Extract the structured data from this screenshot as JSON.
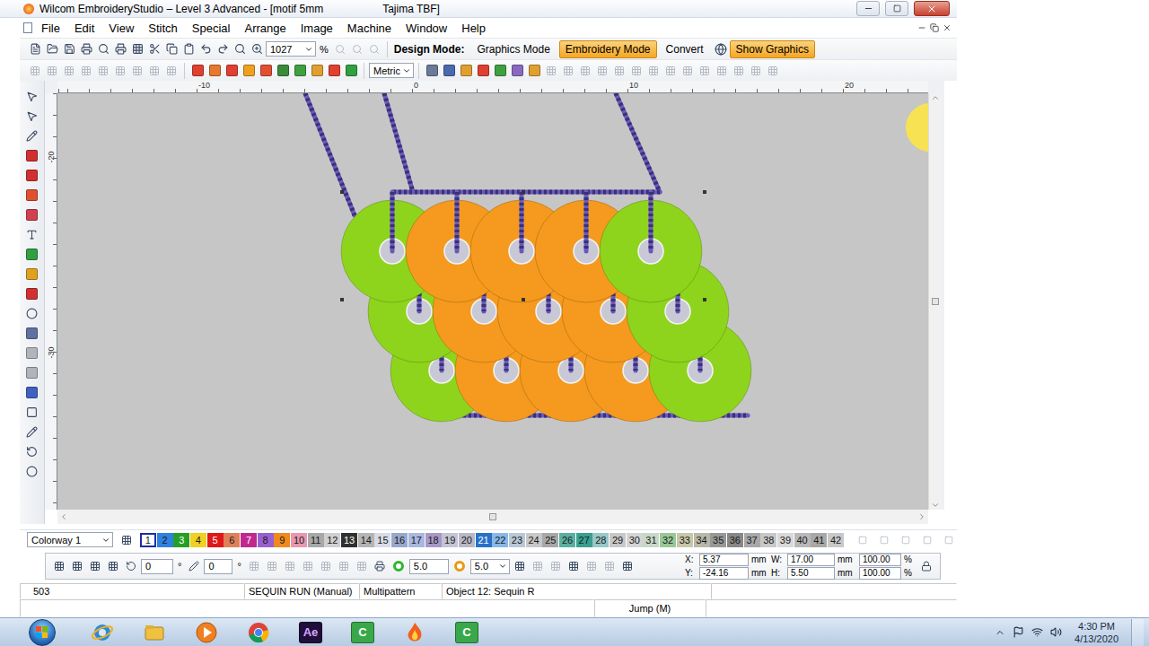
{
  "window": {
    "title": "Wilcom EmbroideryStudio – Level 3 Advanced - [motif 5mm",
    "document_info": "Tajima TBF]"
  },
  "menu": [
    "File",
    "Edit",
    "View",
    "Stitch",
    "Special",
    "Arrange",
    "Image",
    "Machine",
    "Window",
    "Help"
  ],
  "toolbar": {
    "zoom": "1027",
    "zoom_unit": "%",
    "design_mode_label": "Design Mode:",
    "modes": [
      {
        "label": "Graphics Mode",
        "selected": false
      },
      {
        "label": "Embroidery Mode",
        "selected": true
      }
    ],
    "convert": "Convert",
    "show_graphics": {
      "label": "Show Graphics",
      "on": true
    },
    "units": "Metric"
  },
  "rulers": {
    "horizontal": [
      "-10",
      "0",
      "10",
      "20"
    ],
    "vertical": [
      "-20",
      "-30"
    ]
  },
  "design": {
    "rows": [
      {
        "sequins": [
          {
            "color": "#8ed41c"
          },
          {
            "color": "#f59a1e"
          },
          {
            "color": "#f59a1e"
          },
          {
            "color": "#f59a1e"
          },
          {
            "color": "#8ed41c"
          }
        ]
      },
      {
        "sequins": [
          {
            "color": "#8ed41c"
          },
          {
            "color": "#f59a1e"
          },
          {
            "color": "#f59a1e"
          },
          {
            "color": "#f59a1e"
          },
          {
            "color": "#8ed41c"
          }
        ]
      },
      {
        "sequins": [
          {
            "color": "#8ed41c"
          },
          {
            "color": "#f59a1e"
          },
          {
            "color": "#f59a1e"
          },
          {
            "color": "#f59a1e"
          },
          {
            "color": "#8ed41c"
          }
        ]
      }
    ]
  },
  "palette": {
    "colorway": "Colorway 1",
    "swatches": [
      {
        "label": "1",
        "color": "#ffffff",
        "selected": true
      },
      {
        "label": "2",
        "color": "#2f80e0",
        "selected": false
      },
      {
        "label": "3",
        "color": "#25a025",
        "selected": false
      },
      {
        "label": "4",
        "color": "#f0d020",
        "selected": false
      },
      {
        "label": "5",
        "color": "#e01818",
        "selected": false
      },
      {
        "label": "6",
        "color": "#e0805a",
        "selected": false
      },
      {
        "label": "7",
        "color": "#c02890",
        "selected": false
      },
      {
        "label": "8",
        "color": "#9860d0",
        "selected": false
      },
      {
        "label": "9",
        "color": "#f08a1c",
        "selected": false
      },
      {
        "label": "10",
        "color": "#e898b0",
        "selected": false
      },
      {
        "label": "11",
        "color": "#a8a8a8",
        "selected": false
      },
      {
        "label": "12",
        "color": "#d0d0d0",
        "selected": false
      },
      {
        "label": "13",
        "color": "#303030",
        "selected": false
      },
      {
        "label": "14",
        "color": "#b4b4b4",
        "selected": false
      },
      {
        "label": "15",
        "color": "#d8dce8",
        "selected": false
      },
      {
        "label": "16",
        "color": "#98a8cc",
        "selected": false
      },
      {
        "label": "17",
        "color": "#a8b8e0",
        "selected": false
      },
      {
        "label": "18",
        "color": "#a898c8",
        "selected": false
      },
      {
        "label": "19",
        "color": "#c4c4d4",
        "selected": false
      },
      {
        "label": "20",
        "color": "#b8b8c8",
        "selected": false
      },
      {
        "label": "21",
        "color": "#2870c8",
        "selected": false
      },
      {
        "label": "22",
        "color": "#88b8e8",
        "selected": false
      },
      {
        "label": "23",
        "color": "#b8c8d8",
        "selected": false
      },
      {
        "label": "24",
        "color": "#c8c8c8",
        "selected": false
      },
      {
        "label": "25",
        "color": "#a8a8a8",
        "selected": false
      },
      {
        "label": "26",
        "color": "#58b0a0",
        "selected": false
      },
      {
        "label": "27",
        "color": "#38a090",
        "selected": false
      },
      {
        "label": "28",
        "color": "#98c8c8",
        "selected": false
      },
      {
        "label": "29",
        "color": "#c8c8c8",
        "selected": false
      },
      {
        "label": "30",
        "color": "#d4d4d4",
        "selected": false
      },
      {
        "label": "31",
        "color": "#c8d8c8",
        "selected": false
      },
      {
        "label": "32",
        "color": "#98c898",
        "selected": false
      },
      {
        "label": "33",
        "color": "#c8c8a8",
        "selected": false
      },
      {
        "label": "34",
        "color": "#b8b8a8",
        "selected": false
      },
      {
        "label": "35",
        "color": "#989898",
        "selected": false
      },
      {
        "label": "36",
        "color": "#888888",
        "selected": false
      },
      {
        "label": "37",
        "color": "#a8a8a8",
        "selected": false
      },
      {
        "label": "38",
        "color": "#c8c8c8",
        "selected": false
      },
      {
        "label": "39",
        "color": "#d8d8d8",
        "selected": false
      },
      {
        "label": "40",
        "color": "#b8b8b8",
        "selected": false
      },
      {
        "label": "41",
        "color": "#a8a8a8",
        "selected": false
      },
      {
        "label": "42",
        "color": "#c8c8c8",
        "selected": false
      }
    ]
  },
  "properties": {
    "rotate": {
      "value": "0",
      "unit": "°"
    },
    "skew": {
      "value": "0",
      "unit": "°"
    },
    "sequins": [
      {
        "value": "5.0",
        "color": "#2fb52f"
      },
      {
        "value": "5.0",
        "color": "#e89a10"
      }
    ],
    "position": [
      {
        "label": "X:",
        "value": "5.37",
        "unit": "mm"
      },
      {
        "label": "Y:",
        "value": "-24.16",
        "unit": "mm"
      }
    ],
    "size": [
      {
        "label": "W:",
        "value": "17.00",
        "unit": "mm",
        "scale": "100.00",
        "scale_unit": "%"
      },
      {
        "label": "H:",
        "value": "5.50",
        "unit": "mm",
        "scale": "100.00",
        "scale_unit": "%"
      }
    ]
  },
  "status_bar": {
    "count": "503",
    "stitch_type": "SEQUIN RUN (Manual)",
    "pattern": "Multipattern",
    "object": "Object 12: Sequin R",
    "hint": "Jump (M)"
  },
  "taskbar": {
    "apps": [
      {
        "kind": "ie"
      },
      {
        "kind": "explorer"
      },
      {
        "kind": "media"
      },
      {
        "kind": "chrome"
      },
      {
        "kind": "after-effects",
        "label": "Ae"
      },
      {
        "kind": "camtasia",
        "label": "C"
      },
      {
        "kind": "flame"
      },
      {
        "kind": "camtasia",
        "label": "C"
      }
    ],
    "clock": {
      "time": "4:30 PM",
      "date": "4/13/2020"
    }
  }
}
